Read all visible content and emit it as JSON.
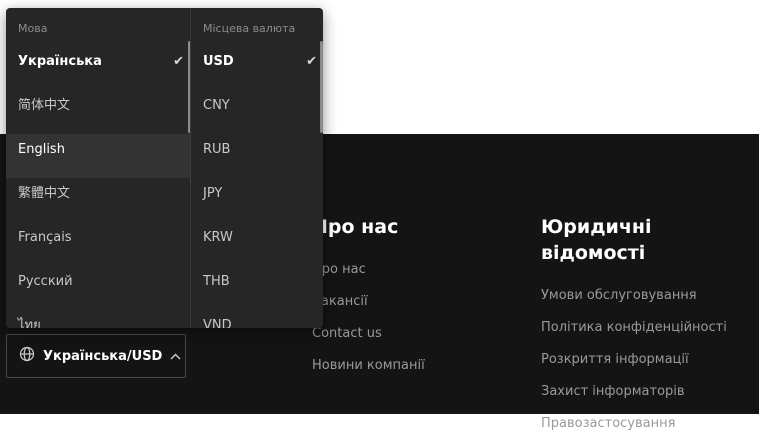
{
  "selector": {
    "label": "Українська/USD",
    "chevron": "^"
  },
  "dropdown": {
    "language_header": "Мова",
    "currency_header": "Місцева валюта",
    "languages": [
      {
        "label": "Українська",
        "selected": true
      },
      {
        "label": "简体中文",
        "selected": false
      },
      {
        "label": "English",
        "selected": false,
        "hover": true
      },
      {
        "label": "繁體中文",
        "selected": false
      },
      {
        "label": "Français",
        "selected": false
      },
      {
        "label": "Русский",
        "selected": false
      },
      {
        "label": "ไทย",
        "selected": false
      }
    ],
    "currencies": [
      {
        "label": "USD",
        "selected": true
      },
      {
        "label": "CNY",
        "selected": false
      },
      {
        "label": "RUB",
        "selected": false
      },
      {
        "label": "JPY",
        "selected": false
      },
      {
        "label": "KRW",
        "selected": false
      },
      {
        "label": "THB",
        "selected": false
      },
      {
        "label": "VND",
        "selected": false
      }
    ],
    "check_glyph": "✔"
  },
  "footer": {
    "about": {
      "heading": "Про нас",
      "links": [
        "Про нас",
        "Вакансії",
        "Contact us",
        "Новини компанії"
      ]
    },
    "legal": {
      "heading": "Юридичні відомості",
      "links": [
        "Умови обслуговування",
        "Політика конфіденційності",
        "Розкриття інформації",
        "Захист інформаторів",
        "Правозастосування"
      ]
    }
  },
  "colors": {
    "footer_bg": "#141414",
    "dropdown_bg": "#262626",
    "hover_bg": "#333333"
  }
}
